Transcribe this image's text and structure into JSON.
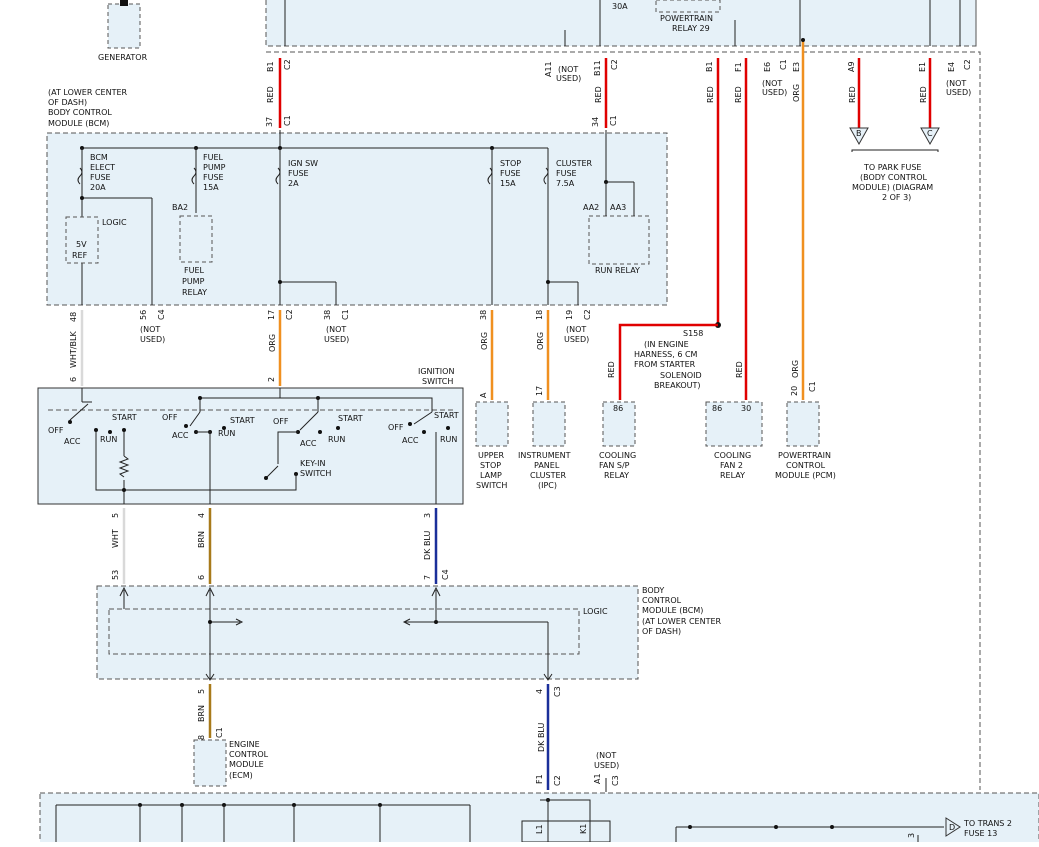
{
  "colors": {
    "red": "#e00000",
    "orange": "#f09020",
    "white": "#d9d9d9",
    "brown": "#a87a1a",
    "dark_blue": "#1a2f9a",
    "module_fill": "#e6f1f8"
  },
  "top": {
    "generator": "GENERATOR",
    "relay_fuse": "30A",
    "powertrain_relay": [
      "POWERTRAIN",
      "RELAY 29"
    ]
  },
  "top_pins": {
    "p1": {
      "pin": "B1",
      "conn": "C2",
      "color": "RED"
    },
    "p2": {
      "pin": "A11",
      "conn": "",
      "note": [
        "(NOT",
        "USED)"
      ]
    },
    "p3": {
      "pin": "B11",
      "conn": "C2",
      "color": "RED"
    },
    "p4": {
      "pin": "B1",
      "color": "RED"
    },
    "p5": {
      "pin": "F1",
      "color": "RED"
    },
    "p6": {
      "pin": "E6",
      "conn": "C1",
      "note": [
        "(NOT",
        "USED)"
      ]
    },
    "p7": {
      "pin": "E3",
      "color": "ORG"
    },
    "p8": {
      "pin": "A9",
      "color": "RED"
    },
    "p9": {
      "pin": "E1",
      "color": "RED"
    },
    "p10": {
      "pin": "E4",
      "conn": "C2",
      "note": [
        "(NOT",
        "USED)"
      ]
    }
  },
  "park_fuse": {
    "conn_b": "B",
    "conn_c": "C",
    "label": [
      "TO PARK FUSE",
      "(BODY CONTROL",
      "MODULE) (DIAGRAM",
      "2 OF 3)"
    ]
  },
  "bcm_top": {
    "label": [
      "(AT LOWER CENTER",
      "OF DASH)",
      "BODY CONTROL",
      "MODULE (BCM)"
    ],
    "pin37": "37",
    "pin37c": "C1",
    "pin34": "34",
    "pin34c": "C1",
    "fuse1": [
      "BCM",
      "ELECT",
      "FUSE",
      "20A"
    ],
    "fuse2": [
      "FUEL",
      "PUMP",
      "FUSE",
      "15A"
    ],
    "fuse3": [
      "IGN SW",
      "FUSE",
      "2A"
    ],
    "fuse4": [
      "STOP",
      "FUSE",
      "15A"
    ],
    "fuse5": [
      "CLUSTER",
      "FUSE",
      "7.5A"
    ],
    "logic": "LOGIC",
    "ref": [
      "5V",
      "REF"
    ],
    "ba2": "BA2",
    "fuel_relay": [
      "FUEL",
      "PUMP",
      "RELAY"
    ],
    "aa2": "AA2",
    "aa3": "AA3",
    "run_relay": "RUN RELAY"
  },
  "mid_pins": {
    "m1": {
      "pin": "48",
      "conn": "",
      "color": "WHT/BLK"
    },
    "m2": {
      "pin": "56",
      "conn": "C4",
      "note": [
        "(NOT",
        "USED)"
      ]
    },
    "m3": {
      "pin": "17",
      "conn": "C2",
      "color": "ORG"
    },
    "m4": {
      "pin": "38",
      "conn": "C1",
      "note": [
        "(NOT",
        "USED)"
      ]
    },
    "m5": {
      "pin": "38",
      "color": "ORG"
    },
    "m6": {
      "pin": "18",
      "color": "ORG"
    },
    "m7": {
      "pin": "19",
      "conn": "C2",
      "note": [
        "(NOT",
        "USED)"
      ]
    }
  },
  "splice": {
    "id": "S158",
    "desc": [
      "(IN ENGINE",
      "HARNESS, 6 CM",
      "FROM STARTER",
      "SOLENOID",
      "BREAKOUT)"
    ]
  },
  "ignition": {
    "title": [
      "IGNITION",
      "SWITCH"
    ],
    "pin6": "6",
    "pin2": "2",
    "off": "OFF",
    "acc": "ACC",
    "run": "RUN",
    "start": "START",
    "keyin": [
      "KEY-IN",
      "SWITCH"
    ],
    "out5": "5",
    "out4": "4",
    "out3": "3"
  },
  "loads": {
    "stop_lamp": {
      "pin": "A",
      "label": [
        "UPPER",
        "STOP",
        "LAMP",
        "SWITCH"
      ]
    },
    "ipc": {
      "pin": "17",
      "label": [
        "INSTRUMENT",
        "PANEL",
        "CLUSTER",
        "(IPC)"
      ]
    },
    "fan_sp": {
      "pin": "86",
      "color": "RED",
      "label": [
        "COOLING",
        "FAN S/P",
        "RELAY"
      ]
    },
    "fan2": {
      "pin_a": "86",
      "pin_b": "30",
      "color": "RED",
      "label": [
        "COOLING",
        "FAN 2",
        "RELAY"
      ]
    },
    "pcm": {
      "pin": "20",
      "conn": "C1",
      "color": "ORG",
      "label": [
        "POWERTRAIN",
        "CONTROL",
        "MODULE (PCM)"
      ]
    }
  },
  "lower_wires": {
    "wht": "WHT",
    "brn": "BRN",
    "dkblu": "DK BLU"
  },
  "bcm_bottom": {
    "label": [
      "BODY",
      "CONTROL",
      "MODULE (BCM)",
      "(AT LOWER CENTER",
      "OF DASH)"
    ],
    "logic": "LOGIC",
    "in53": "53",
    "in6": "6",
    "in7": "7",
    "in7c": "C4",
    "out5": "5",
    "out4": "4",
    "out4c": "C3"
  },
  "ecm": {
    "pin": "8",
    "conn": "C1",
    "color": "BRN",
    "label": [
      "ENGINE",
      "CONTROL",
      "MODULE",
      "(ECM)"
    ]
  },
  "bottom": {
    "f1": "F1",
    "f1c": "C2",
    "a1": "A1",
    "a1c": "C3",
    "note": [
      "(NOT",
      "USED)"
    ],
    "color": "DK BLU",
    "l1": "L1",
    "k1": "K1",
    "pin3": "3",
    "trans": [
      "TO TRANS 2",
      "FUSE 13"
    ],
    "conn_d": "D"
  }
}
